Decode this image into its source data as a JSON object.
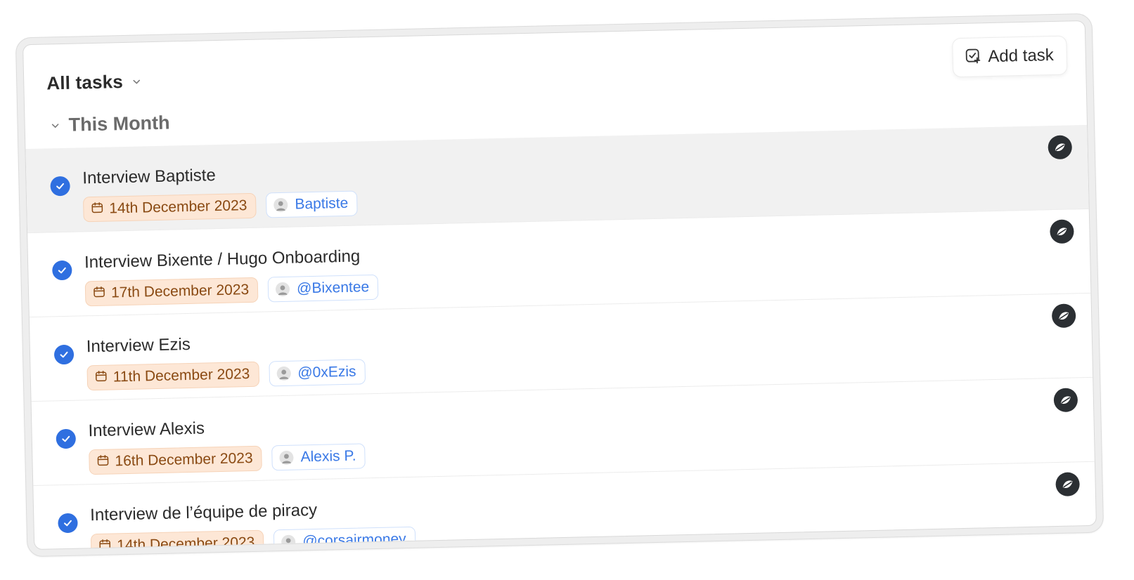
{
  "header": {
    "view_label": "All tasks",
    "add_task_label": "Add task"
  },
  "section": {
    "label": "This Month"
  },
  "tasks": [
    {
      "title": "Interview Baptiste",
      "date": "14th December 2023",
      "assignee": "Baptiste",
      "completed": true,
      "highlighted": true
    },
    {
      "title": "Interview Bixente / Hugo Onboarding",
      "date": "17th December 2023",
      "assignee": "@Bixentee",
      "completed": true,
      "highlighted": false
    },
    {
      "title": "Interview Ezis",
      "date": "11th December 2023",
      "assignee": "@0xEzis",
      "completed": true,
      "highlighted": false
    },
    {
      "title": "Interview Alexis",
      "date": "16th December 2023",
      "assignee": "Alexis P.",
      "completed": true,
      "highlighted": false
    },
    {
      "title": "Interview de l’équipe de piracy",
      "date": "14th December 2023",
      "assignee": "@corsairmoney",
      "completed": true,
      "highlighted": false
    }
  ],
  "icons": {
    "add_task": "checkbox-plus-icon",
    "view_dropdown": "chevron-down-icon",
    "section_toggle": "chevron-down-icon",
    "completed": "check-circle-icon",
    "date": "calendar-icon",
    "assignee": "user-avatar-icon",
    "source": "app-logo-icon"
  },
  "colors": {
    "check": "#2f6fe0",
    "date_bg": "#fde7d6",
    "date_text": "#8a4a13",
    "user_text": "#3a79e6",
    "highlight_row": "#f1f1f1"
  }
}
